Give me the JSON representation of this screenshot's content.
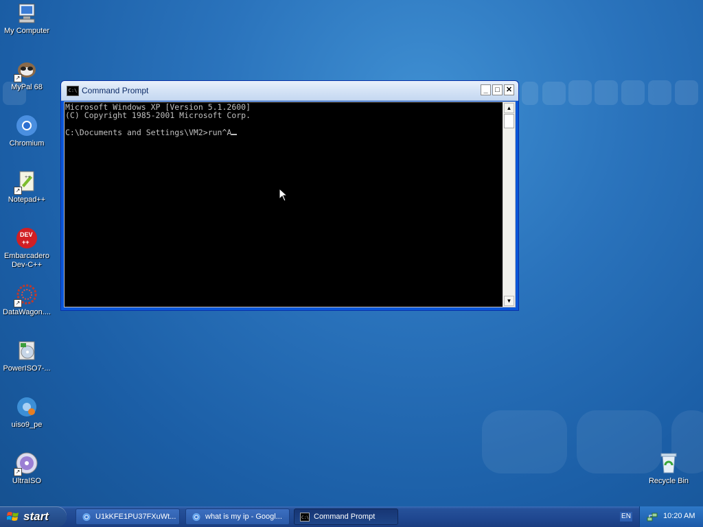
{
  "desktop": {
    "icons": [
      {
        "label": "My Computer",
        "icon": "my-computer-icon"
      },
      {
        "label": "MyPal 68",
        "icon": "mypal-icon"
      },
      {
        "label": "Chromium",
        "icon": "chromium-icon"
      },
      {
        "label": "Notepad++",
        "icon": "notepadpp-icon"
      },
      {
        "label": "Embarcadero Dev-C++",
        "icon": "devcpp-icon"
      },
      {
        "label": "DataWagon....",
        "icon": "datawagon-icon"
      },
      {
        "label": "PowerISO7-...",
        "icon": "poweriso-icon"
      },
      {
        "label": "uiso9_pe",
        "icon": "uiso-icon"
      },
      {
        "label": "UltraISO",
        "icon": "ultraiso-icon"
      },
      {
        "label": "Recycle Bin",
        "icon": "recycle-bin-icon"
      }
    ]
  },
  "window": {
    "title": "Command Prompt",
    "icon_text": "C:\\",
    "buttons": {
      "minimize": "_",
      "maximize": "□",
      "close": "✕"
    },
    "console_lines": [
      "Microsoft Windows XP [Version 5.1.2600]",
      "(C) Copyright 1985-2001 Microsoft Corp.",
      "",
      "C:\\Documents and Settings\\VM2>run^A"
    ]
  },
  "taskbar": {
    "start_label": "start",
    "buttons": [
      {
        "label": "U1kKFE1PU37FXuWt...",
        "icon": "chromium-icon",
        "active": false
      },
      {
        "label": "what is my ip - Googl...",
        "icon": "chromium-icon",
        "active": false
      },
      {
        "label": "Command Prompt",
        "icon": "cmd-icon",
        "active": true
      }
    ],
    "language": "EN",
    "clock": "10:20 AM"
  },
  "colors": {
    "desktop_bg": "#2a73bc",
    "window_border": "#0a56d8",
    "console_bg": "#000000",
    "console_fg": "#c0c0c0",
    "taskbar": "#1f4790"
  }
}
